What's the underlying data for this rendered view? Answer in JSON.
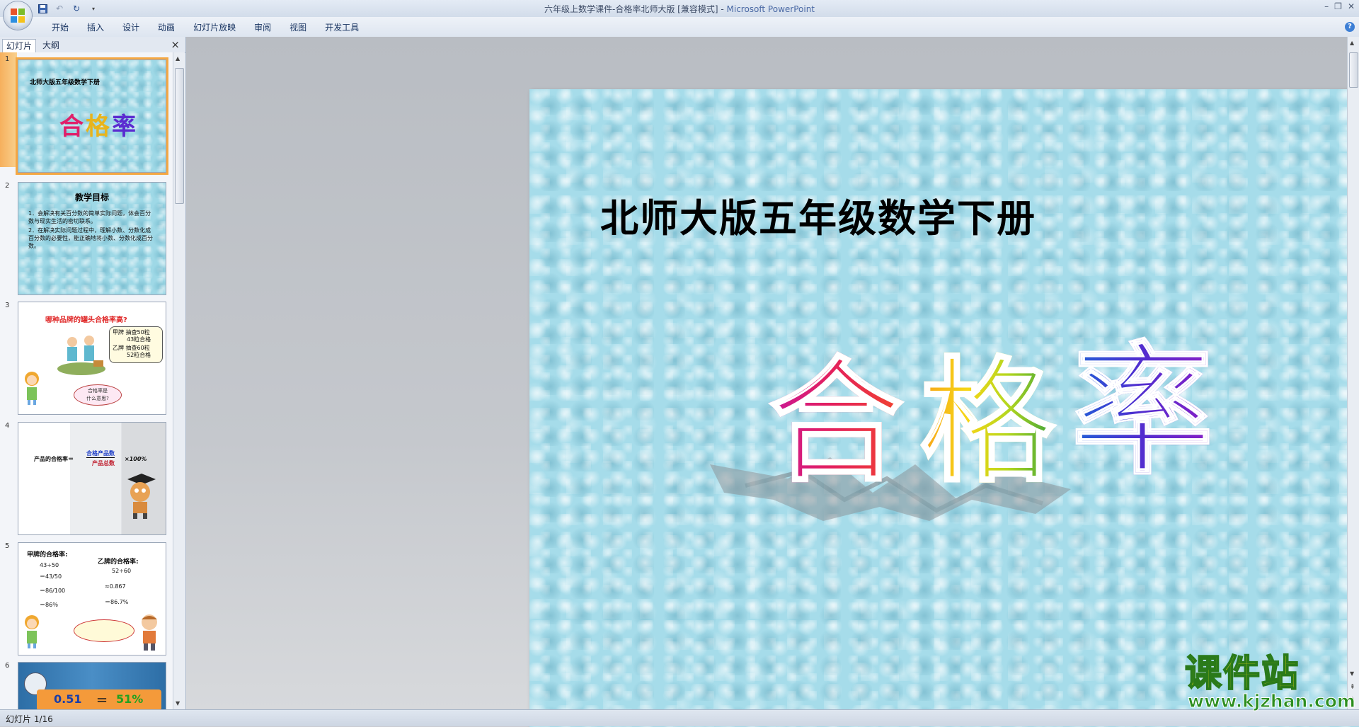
{
  "window": {
    "title": "六年级上数学课件-合格率北师大版 [兼容模式]",
    "app_name": "Microsoft PowerPoint"
  },
  "quick_access": {
    "save": "save-icon",
    "undo": "undo-icon",
    "redo": "redo-icon"
  },
  "ribbon": {
    "tabs": [
      "开始",
      "插入",
      "设计",
      "动画",
      "幻灯片放映",
      "审阅",
      "视图",
      "开发工具"
    ]
  },
  "panel": {
    "tabs": [
      "幻灯片",
      "大纲"
    ],
    "close": "×"
  },
  "thumbnails": [
    {
      "number": "1",
      "title": "北师大版五年级数学下册",
      "art": [
        "合",
        "格",
        "率"
      ]
    },
    {
      "number": "2",
      "title": "教学目标",
      "lines": [
        "1．会解决有关百分数的简单实际问题，体会百分数与现实生活的密切联系。",
        "2．在解决实际问题过程中，理解小数、分数化成百分数的必要性，能正确地将小数、分数化成百分数。"
      ]
    },
    {
      "number": "3",
      "title": "哪种品牌的罐头合格率高?",
      "box": [
        "甲牌  抽查50粒",
        "43粒合格",
        "乙牌  抽查60粒",
        "52粒合格"
      ],
      "bubble": [
        "合格率是",
        "什么意思?"
      ]
    },
    {
      "number": "4",
      "formula_left": "产品的合格率＝",
      "formula_num": "合格产品数",
      "formula_den": "产品总数",
      "formula_right": "×100%"
    },
    {
      "number": "5",
      "left_title": "甲牌的合格率:",
      "left_lines": [
        "43÷50",
        "＝43/50",
        "＝86/100",
        "＝86％"
      ],
      "right_title": "乙牌的合格率:",
      "right_lines": [
        "52÷60",
        "≈0.867",
        "＝86.7%"
      ]
    },
    {
      "number": "6",
      "text_a": "0.51",
      "text_eq": "＝",
      "text_b": "51%"
    }
  ],
  "slide": {
    "title": "北师大版五年级数学下册",
    "art_chars": [
      "合",
      "格",
      "率"
    ]
  },
  "status": {
    "text": "幻灯片 1/16"
  },
  "watermark": {
    "cn": "课件站",
    "url": "www.kjzhan.com"
  }
}
